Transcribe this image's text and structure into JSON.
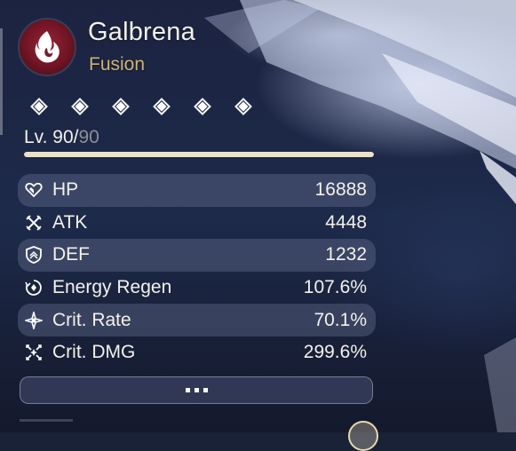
{
  "character": {
    "name": "Galbrena",
    "element": "Fusion",
    "attribute_icon": "fusion-flame-icon",
    "resonance_chain_icon": "diamond-node-icon"
  },
  "level": {
    "prefix": "Lv. ",
    "current": "90",
    "separator": "/",
    "max": "90",
    "progress": 1.0
  },
  "stats": [
    {
      "label": "HP",
      "value": "16888",
      "icon": "heart-icon"
    },
    {
      "label": "ATK",
      "value": "4448",
      "icon": "crossed-swords-icon"
    },
    {
      "label": "DEF",
      "value": "1232",
      "icon": "shield-icon"
    },
    {
      "label": "Energy Regen",
      "value": "107.6%",
      "icon": "energy-regen-icon"
    },
    {
      "label": "Crit. Rate",
      "value": "70.1%",
      "icon": "crit-rate-icon"
    },
    {
      "label": "Crit. DMG",
      "value": "299.6%",
      "icon": "crit-dmg-icon"
    }
  ],
  "more_button_icon": "more-dots-icon",
  "colors": {
    "element_text": "#ccb174",
    "level_max_text": "#8c8e97",
    "level_bar_fill": "#e9e3cc",
    "row_shade": "#78829f",
    "attribute_icon_bg": "#9b2434"
  }
}
